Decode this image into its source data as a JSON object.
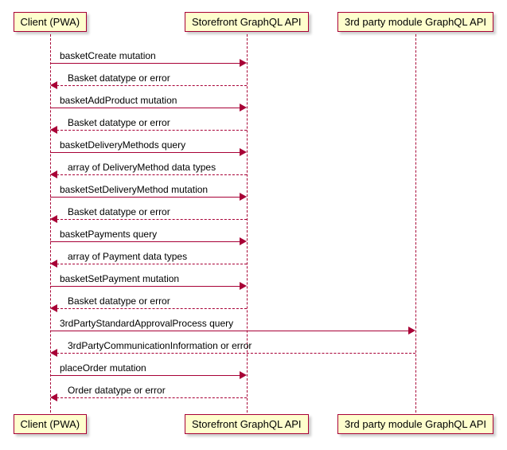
{
  "participants": {
    "client": "Client (PWA)",
    "storefront": "Storefront GraphQL API",
    "thirdparty": "3rd party module GraphQL API"
  },
  "messages": [
    {
      "label": "basketCreate mutation",
      "from": "client",
      "to": "storefront",
      "dashed": false
    },
    {
      "label": "Basket datatype or error",
      "from": "storefront",
      "to": "client",
      "dashed": true
    },
    {
      "label": "basketAddProduct mutation",
      "from": "client",
      "to": "storefront",
      "dashed": false
    },
    {
      "label": "Basket datatype or error",
      "from": "storefront",
      "to": "client",
      "dashed": true
    },
    {
      "label": "basketDeliveryMethods query",
      "from": "client",
      "to": "storefront",
      "dashed": false
    },
    {
      "label": "array of DeliveryMethod data types",
      "from": "storefront",
      "to": "client",
      "dashed": true
    },
    {
      "label": "basketSetDeliveryMethod mutation",
      "from": "client",
      "to": "storefront",
      "dashed": false
    },
    {
      "label": "Basket datatype or error",
      "from": "storefront",
      "to": "client",
      "dashed": true
    },
    {
      "label": "basketPayments query",
      "from": "client",
      "to": "storefront",
      "dashed": false
    },
    {
      "label": "array of Payment data types",
      "from": "storefront",
      "to": "client",
      "dashed": true
    },
    {
      "label": "basketSetPayment mutation",
      "from": "client",
      "to": "storefront",
      "dashed": false
    },
    {
      "label": "Basket datatype or error",
      "from": "storefront",
      "to": "client",
      "dashed": true
    },
    {
      "label": "3rdPartyStandardApprovalProcess query",
      "from": "client",
      "to": "thirdparty",
      "dashed": false
    },
    {
      "label": "3rdPartyCommunicationInformation or error",
      "from": "thirdparty",
      "to": "client",
      "dashed": true
    },
    {
      "label": "placeOrder mutation",
      "from": "client",
      "to": "storefront",
      "dashed": false
    },
    {
      "label": "Order datatype or error",
      "from": "storefront",
      "to": "client",
      "dashed": true
    }
  ],
  "layout": {
    "lifelineX": {
      "client": 53,
      "storefront": 300,
      "thirdparty": 512
    },
    "topY": 5,
    "bottomY": 510,
    "firstMsgY": 55,
    "msgSpacing": 28
  }
}
